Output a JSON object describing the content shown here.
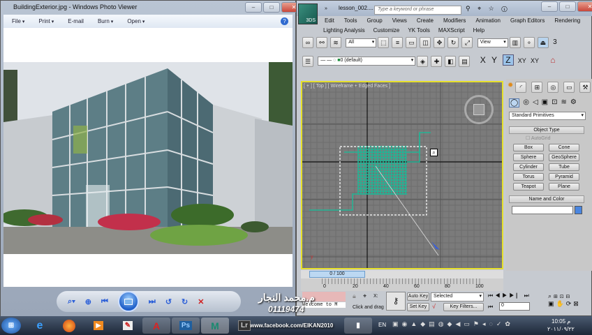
{
  "photo_viewer": {
    "title": "BuildingExterior.jpg - Windows Photo Viewer",
    "menu": [
      "File",
      "Print",
      "E-mail",
      "Burn",
      "Open"
    ],
    "help_icon": "help-icon",
    "controls": [
      "zoom-icon",
      "actual-size-icon",
      "previous-icon",
      "slideshow-icon",
      "next-icon",
      "rotate-counterclockwise-icon",
      "rotate-clockwise-icon",
      "delete-icon"
    ]
  },
  "max": {
    "file_title": "lesson_002....",
    "search_placeholder": "Type a keyword or phrase",
    "logo_text": "3DS",
    "menu_row1": [
      "Edit",
      "Tools",
      "Group",
      "Views",
      "Create",
      "Modifiers",
      "Animation",
      "Graph Editors",
      "Rendering"
    ],
    "menu_row2": [
      "Lighting Analysis",
      "Customize",
      "YK Tools",
      "MAXScript",
      "Help"
    ],
    "selection_filter": "All",
    "ref_coord": "View",
    "snap_label": "3",
    "layer": "0 (default)",
    "axes": [
      "X",
      "Y",
      "Z",
      "XY",
      "XY"
    ],
    "viewport_label": "[ + ] [ Top ] [ Wireframe + Edged Faces ]",
    "command_panel": {
      "category": "Standard Primitives",
      "object_type_title": "Object Type",
      "autogrid": "AutoGrid",
      "buttons": [
        "Box",
        "Cone",
        "Sphere",
        "GeoSphere",
        "Cylinder",
        "Tube",
        "Torus",
        "Pyramid",
        "Teapot",
        "Plane"
      ],
      "name_color_title": "Name and Color",
      "name_value": "",
      "color": "#4a86e0"
    },
    "timeline": {
      "frame": "0 / 100",
      "ticks": [
        "0",
        "20",
        "40",
        "60",
        "80",
        "100"
      ]
    },
    "status": {
      "welcome": "Welcome to M",
      "prompt": "Click and drag",
      "x_label": "X:",
      "auto_key": "Auto Key",
      "set_key": "Set Key",
      "key_mode": "Selected",
      "key_filters": "Key Filters...",
      "current_frame": "0"
    }
  },
  "taskbar": {
    "language": "EN",
    "time": "10:05 م",
    "date": "٢٠١١/٠٩/٢٢",
    "apps": [
      "Lr",
      "Ps"
    ]
  },
  "watermark": {
    "name": "م.محمد النجار",
    "phone": "01119474",
    "site": "www.facebook.com/EIKAN2010"
  }
}
